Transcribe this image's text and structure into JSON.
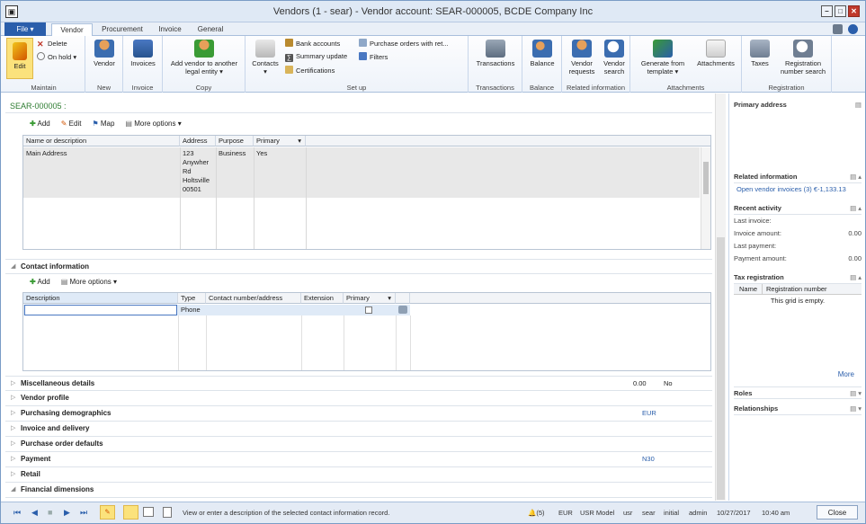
{
  "window": {
    "title": "Vendors (1 - sear) - Vendor account: SEAR-000005, BCDE Company Inc",
    "app_icon": "dynamics-icon"
  },
  "tabs": [
    {
      "label": "File"
    },
    {
      "label": "Vendor"
    },
    {
      "label": "Procurement"
    },
    {
      "label": "Invoice"
    },
    {
      "label": "General"
    }
  ],
  "ribbon": {
    "maintain": {
      "edit": "Edit",
      "delete": "Delete",
      "on_hold": "On hold",
      "caption": "Maintain"
    },
    "new": {
      "vendor": "Vendor",
      "caption": "New"
    },
    "invoice": {
      "invoices": "Invoices",
      "caption": "Invoice"
    },
    "copy": {
      "add_vendor": "Add vendor to another legal entity",
      "caption": "Copy"
    },
    "setup": {
      "contacts": "Contacts",
      "bank_accounts": "Bank accounts",
      "summary_update": "Summary update",
      "certifications": "Certifications",
      "purchase_orders_with": "Purchase orders with ret...",
      "filters": "Filters",
      "caption": "Set up"
    },
    "transactions": {
      "transactions": "Transactions",
      "caption": "Transactions"
    },
    "balance": {
      "balance": "Balance",
      "caption": "Balance"
    },
    "related": {
      "vendor_requests": "Vendor requests",
      "vendor_search": "Vendor search",
      "caption": "Related information"
    },
    "attachments": {
      "generate": "Generate from template",
      "attachments": "Attachments",
      "caption": "Attachments"
    },
    "registration": {
      "taxes": "Taxes",
      "reg_search": "Registration number search",
      "caption": "Registration"
    }
  },
  "account": "SEAR-000005 :",
  "address_toolbar": {
    "add": "Add",
    "edit": "Edit",
    "map": "Map",
    "more": "More options"
  },
  "address_grid": {
    "headers": [
      "Name or description",
      "Address",
      "Purpose",
      "Primary"
    ],
    "rows": [
      {
        "name": "Main Address",
        "address": "123 Anywher Rd Holtsville 00501",
        "purpose": "Business",
        "primary": "Yes"
      }
    ]
  },
  "contact": {
    "title": "Contact information",
    "toolbar": {
      "add": "Add",
      "more": "More options"
    },
    "headers": [
      "Description",
      "Type",
      "Contact number/address",
      "Extension",
      "Primary"
    ],
    "row": {
      "description": "",
      "type": "Phone"
    }
  },
  "sections": [
    {
      "label": "Miscellaneous details",
      "sum1": "0.00",
      "sum2": "No"
    },
    {
      "label": "Vendor profile",
      "sum1": "",
      "sum2": ""
    },
    {
      "label": "Purchasing demographics",
      "sum1": "EUR",
      "sum2": ""
    },
    {
      "label": "Invoice and delivery",
      "sum1": "",
      "sum2": ""
    },
    {
      "label": "Purchase order defaults",
      "sum1": "",
      "sum2": ""
    },
    {
      "label": "Payment",
      "sum1": "N30",
      "sum2": ""
    },
    {
      "label": "Retail",
      "sum1": "",
      "sum2": ""
    },
    {
      "label": "Financial dimensions",
      "sum1": "",
      "sum2": ""
    }
  ],
  "factbox": {
    "primary_address": "Primary address",
    "related_information": "Related information",
    "open_invoices": "Open vendor invoices (3) €-1,133.13",
    "recent_activity": "Recent activity",
    "activity": [
      {
        "k": "Last invoice:",
        "v": ""
      },
      {
        "k": "Invoice amount:",
        "v": "0.00"
      },
      {
        "k": "Last payment:",
        "v": ""
      },
      {
        "k": "Payment amount:",
        "v": "0.00"
      }
    ],
    "tax_registration": "Tax registration",
    "tax_headers": [
      "Name",
      "Registration number"
    ],
    "tax_empty": "This grid is empty.",
    "more": "More",
    "roles": "Roles",
    "relationships": "Relationships"
  },
  "status": {
    "message": "View or enter a description of the selected contact information record.",
    "items": [
      "(5)",
      "EUR",
      "USR Model",
      "usr",
      "sear",
      "initial",
      "admin",
      "10/27/2017",
      "10:40 am"
    ],
    "close": "Close"
  }
}
